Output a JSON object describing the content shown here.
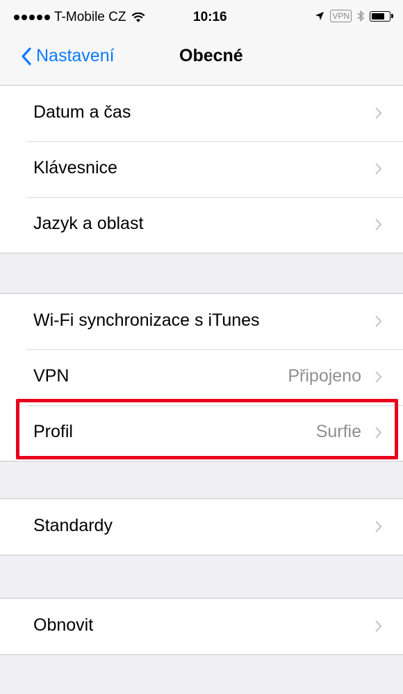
{
  "status_bar": {
    "carrier": "T-Mobile CZ",
    "time": "10:16",
    "vpn_label": "VPN",
    "icons": [
      "signal-dots-icon",
      "wifi-icon",
      "location-arrow-icon",
      "bluetooth-icon",
      "battery-icon"
    ]
  },
  "nav": {
    "back_label": "Nastavení",
    "title": "Obecné"
  },
  "groups": [
    {
      "rows": [
        {
          "label": "Datum a čas",
          "value": ""
        },
        {
          "label": "Klávesnice",
          "value": ""
        },
        {
          "label": "Jazyk a oblast",
          "value": ""
        }
      ]
    },
    {
      "rows": [
        {
          "label": "Wi-Fi synchronizace s iTunes",
          "value": ""
        },
        {
          "label": "VPN",
          "value": "Připojeno"
        },
        {
          "label": "Profil",
          "value": "Surfie"
        }
      ]
    },
    {
      "rows": [
        {
          "label": "Standardy",
          "value": ""
        }
      ]
    },
    {
      "rows": [
        {
          "label": "Obnovit",
          "value": ""
        }
      ]
    }
  ],
  "colors": {
    "accent": "#0a7bff",
    "highlight": "#e8001c",
    "background": "#efeff4"
  }
}
